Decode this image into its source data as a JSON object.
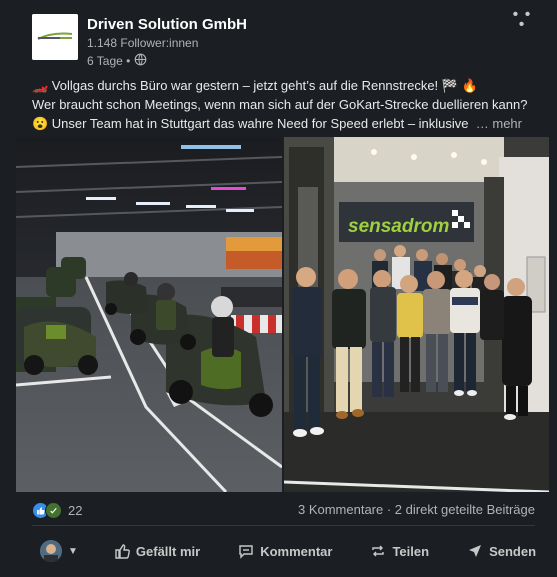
{
  "post": {
    "company_name": "Driven Solution GmbH",
    "followers": "1.148 Follower:innen",
    "age": "6 Tage •",
    "lines": [
      "🏎️ Vollgas durchs Büro war gestern – jetzt geht’s auf die Rennstrecke! 🏁 🔥",
      "Wer braucht schon Meetings, wenn man sich auf der GoKart-Strecke duellieren kann?",
      "😮 Unser Team hat in Stuttgart das wahre Need for Speed erlebt – inklusive"
    ],
    "more_label": "… mehr",
    "banner_text": "sensadrom"
  },
  "stats": {
    "reaction_count": "22",
    "comments_shares": "3 Kommentare · 2 direkt geteilte Beiträge"
  },
  "actions": {
    "like": "Gefällt mir",
    "comment": "Kommentar",
    "share": "Teilen",
    "send": "Senden"
  },
  "colors": {
    "background": "#1b1f23",
    "text": "#e9e9e9",
    "muted": "#b0b3b8",
    "like_blue": "#378fe9",
    "support_green": "#44712e"
  },
  "icons": {
    "visibility": "globe-icon",
    "more": "more-dots-icon",
    "like": "thumbs-up-icon",
    "comment": "comment-icon",
    "share": "repost-icon",
    "send": "send-icon"
  }
}
